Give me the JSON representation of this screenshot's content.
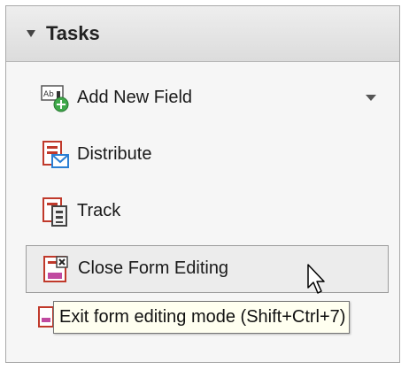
{
  "panel": {
    "title": "Tasks"
  },
  "items": [
    {
      "label": "Add New Field",
      "icon": "add-field-icon",
      "has_dropdown": true
    },
    {
      "label": "Distribute",
      "icon": "distribute-icon"
    },
    {
      "label": "Track",
      "icon": "track-icon"
    },
    {
      "label": "Close Form Editing",
      "icon": "close-form-editing-icon",
      "state": "hover"
    }
  ],
  "tooltip": {
    "text": "Exit form editing mode (Shift+Ctrl+7)"
  },
  "colors": {
    "header_bg": "#e2e2e2",
    "panel_bg": "#f6f6f6",
    "hover_border": "#9c9c9c",
    "tooltip_bg": "#fffff0",
    "icon_red": "#c0392b",
    "icon_pink": "#c04aa0",
    "icon_blue": "#2a7fd4"
  }
}
